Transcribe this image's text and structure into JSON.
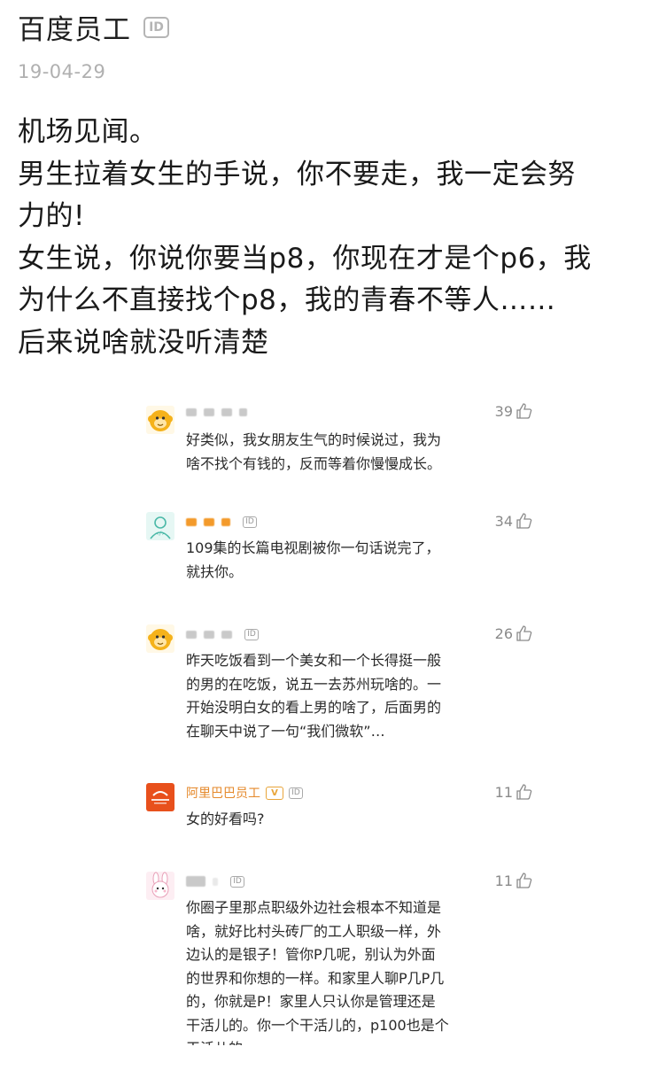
{
  "post": {
    "author": "百度员工",
    "id_badge": "ID",
    "date": "19-04-29",
    "lines": [
      "机场见闻。",
      "男生拉着女生的手说，你不要走，我一定会努",
      "力的!",
      "女生说，你说你要当p8，你现在才是个p6，我",
      "为什么不直接找个p8，我的青春不等人……",
      "后来说啥就没听清楚"
    ]
  },
  "comments": [
    {
      "author": "",
      "likes": "39",
      "avatar": "monkey-avatar",
      "lines": [
        "好类似，我女朋友生气的时候说过，我为",
        "啥不找个有钱的，反而等着你慢慢成长。"
      ]
    },
    {
      "author": "",
      "likes": "34",
      "avatar": "user-avatar",
      "id_badge": "ID",
      "lines": [
        "109集的长篇电视剧被你一句话说完了，",
        "就扶你。"
      ]
    },
    {
      "author": "",
      "likes": "26",
      "avatar": "monkey-avatar",
      "id_badge": "ID",
      "lines": [
        "昨天吃饭看到一个美女和一个长得挺一般",
        "的男的在吃饭，说五一去苏州玩啥的。一",
        "开始没明白女的看上男的啥了，后面男的",
        "在聊天中说了一句“我们微软”…"
      ]
    },
    {
      "author": "阿里巴巴员工",
      "likes": "11",
      "avatar": "alibaba-avatar",
      "id_badge": "ID",
      "lines": [
        "女的好看吗?"
      ]
    },
    {
      "author": "",
      "likes": "11",
      "avatar": "rabbit-avatar",
      "id_badge": "ID",
      "lines": [
        "你圈子里那点职级外边社会根本不知道是",
        "啥，就好比村头砖厂的工人职级一样，外",
        "边认的是银子！管你P几呢，别认为外面",
        "的世界和你想的一样。和家里人聊P几P几",
        "的，你就是P！家里人只认你是管理还是",
        "干活儿的。你一个干活儿的，p100也是个",
        "干活儿的"
      ]
    }
  ],
  "colors": {
    "accent_orange": "#e5892b",
    "alibaba_red": "#e8501c",
    "muted": "#b0b0b0"
  }
}
